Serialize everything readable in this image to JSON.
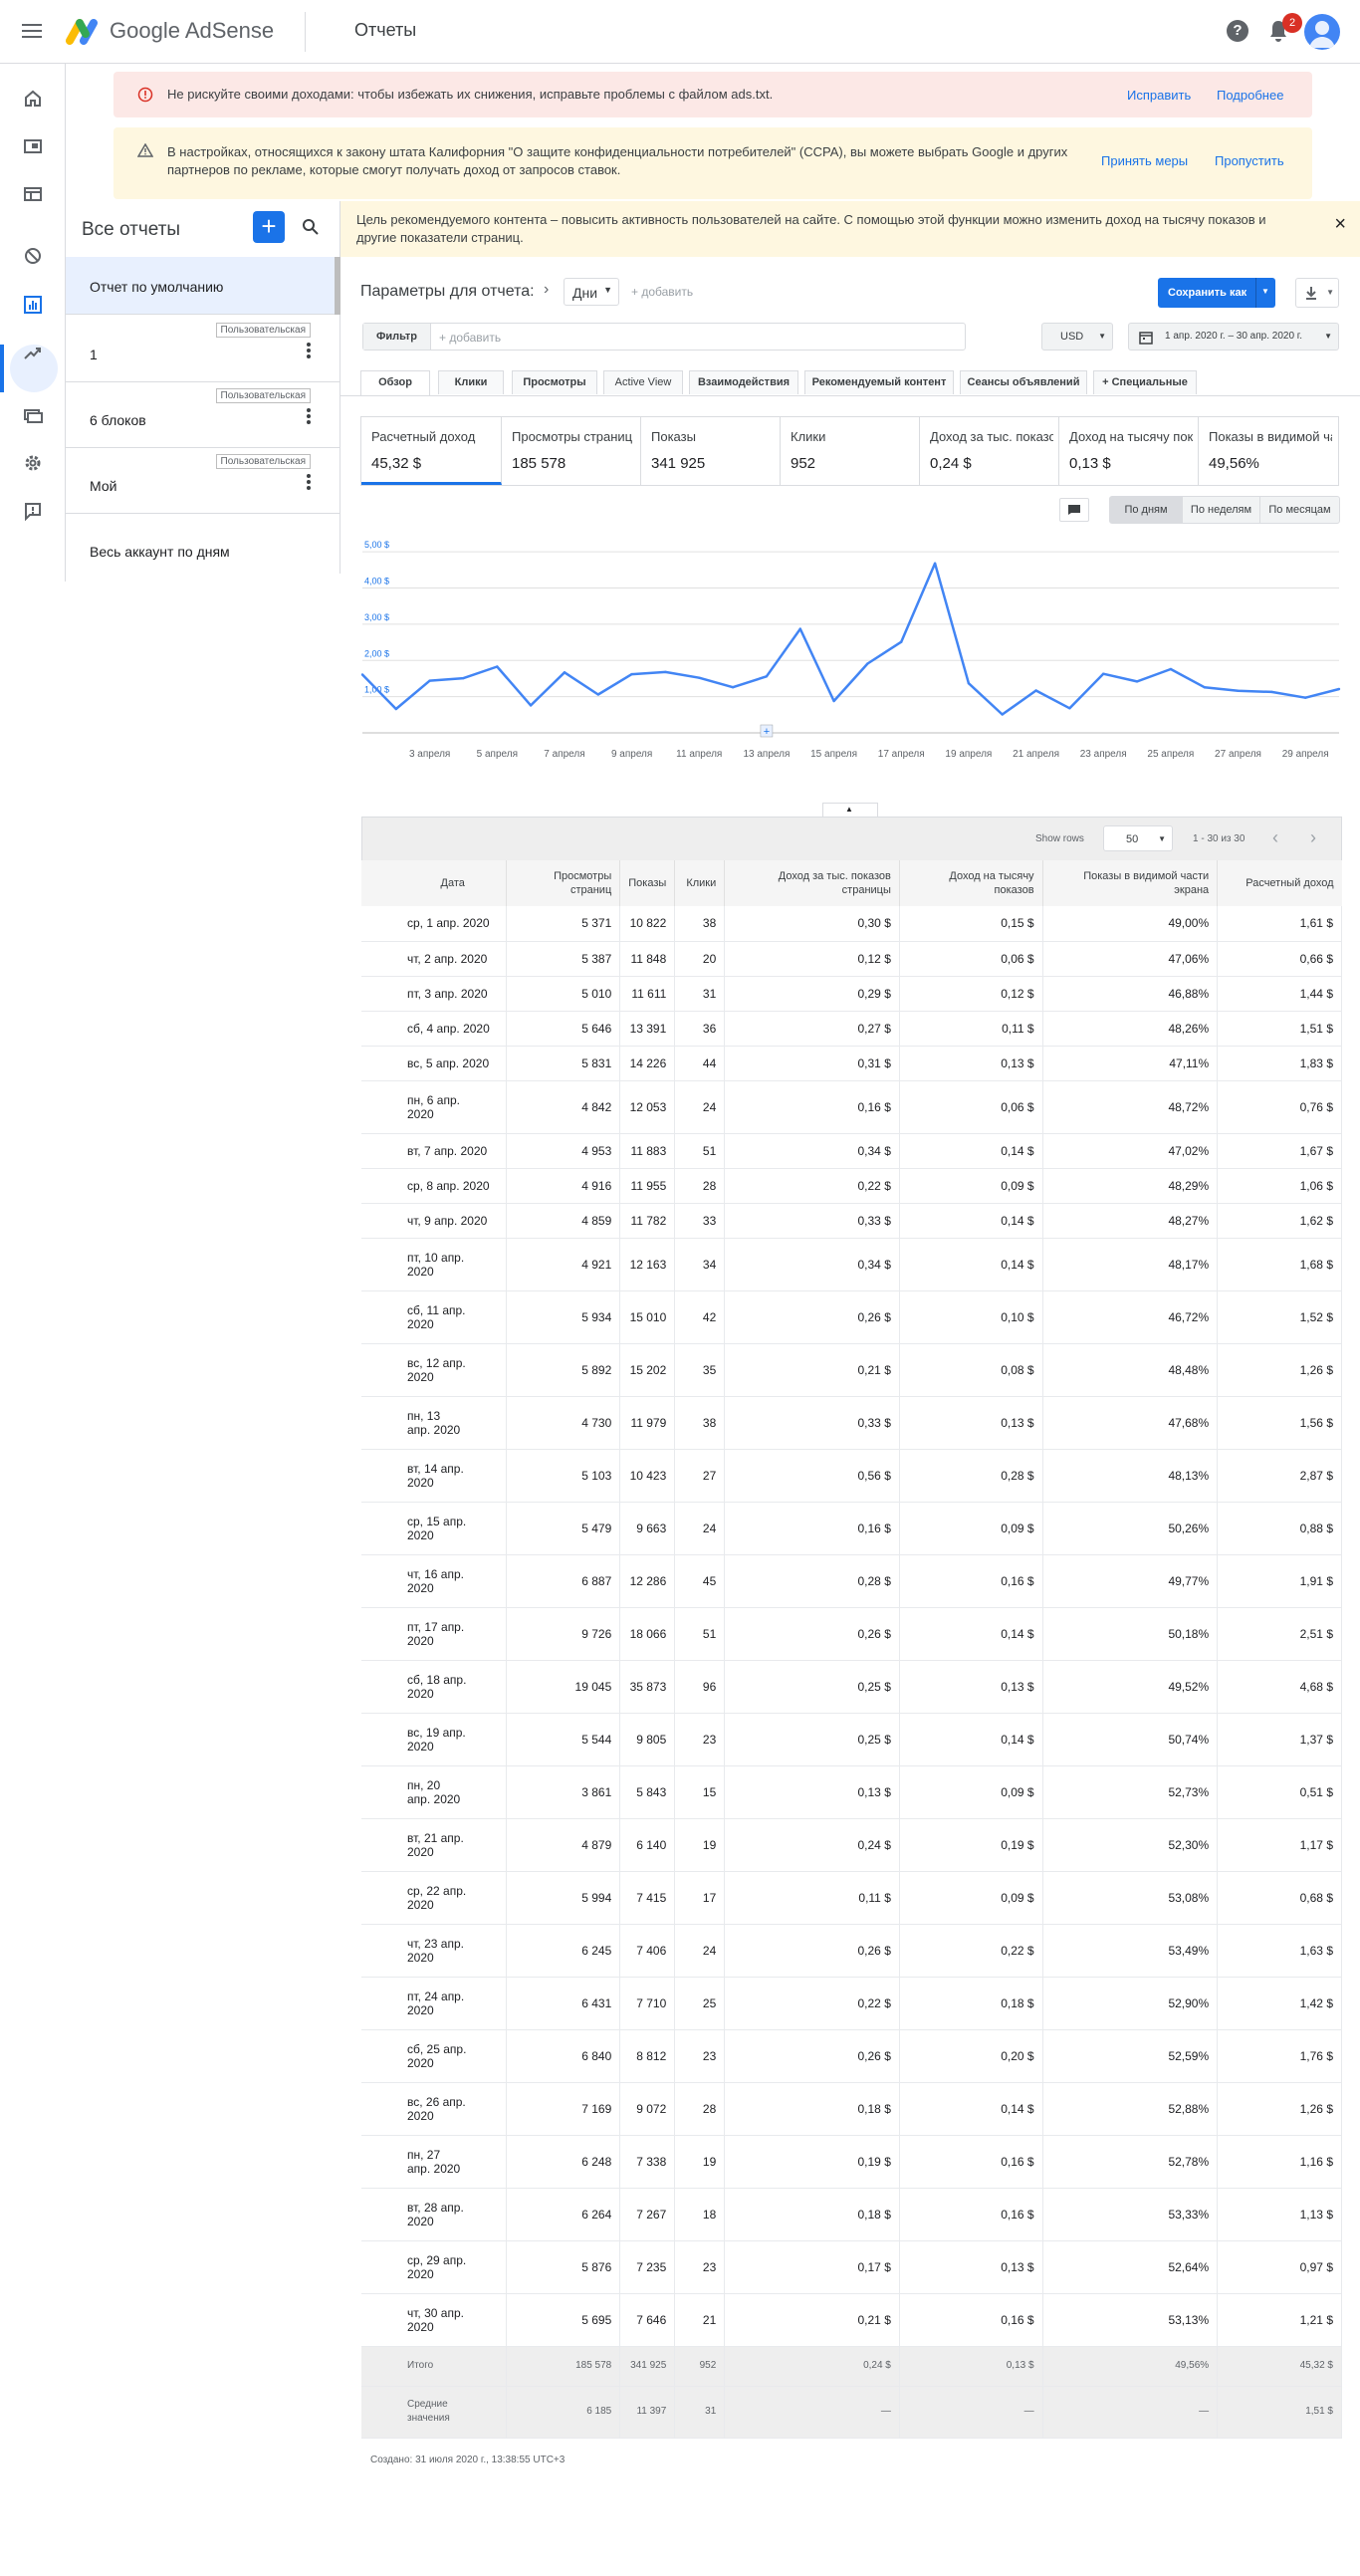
{
  "app": {
    "brand": "Google AdSense",
    "page_title": "Отчеты",
    "notification_count": "2"
  },
  "alerts": [
    {
      "text": "Не рискуйте своими доходами: чтобы избежать их снижения, исправьте проблемы с файлом ads.txt.",
      "action1": "Исправить",
      "action2": "Подробнее"
    },
    {
      "text": "В настройках, относящихся к закону штата Калифорния \"О защите конфиденциальности потребителей\" (CCPA), вы можете выбрать Google и других партнеров по рекламе, которые смогут получать доход от запросов ставок.",
      "action1": "Принять меры",
      "action2": "Пропустить"
    }
  ],
  "reports_panel": {
    "title": "Все отчеты",
    "items": [
      {
        "label": "Отчет по умолчанию",
        "tag": ""
      },
      {
        "label": "1",
        "tag": "Пользовательская"
      },
      {
        "label": "6 блоков",
        "tag": "Пользовательская"
      },
      {
        "label": "Мой",
        "tag": "Пользовательская"
      },
      {
        "label": "Весь аккаунт по дням",
        "tag": ""
      }
    ]
  },
  "banner": {
    "text": "Цель рекомендуемого контента – повысить активность пользователей на сайте. С помощью этой функции можно изменить доход на тысячу показов и другие показатели страниц.",
    "close": "×"
  },
  "params": {
    "label": "Параметры для отчета:",
    "dimension": "Дни",
    "add": "+ добавить",
    "save": "Сохранить как"
  },
  "filter": {
    "label": "Фильтр",
    "placeholder": "+ добавить",
    "currency": "USD",
    "date_range": "1 апр. 2020 г. – 30 апр. 2020 г."
  },
  "tabs": [
    "Обзор",
    "Клики",
    "Просмотры",
    "Active View",
    "Взаимодействия",
    "Рекомендуемый контент",
    "Сеансы объявлений",
    "+  Специальные"
  ],
  "metrics": [
    {
      "label": "Расчетный доход",
      "value": "45,32 $"
    },
    {
      "label": "Просмотры страниц",
      "value": "185 578"
    },
    {
      "label": "Показы",
      "value": "341 925"
    },
    {
      "label": "Клики",
      "value": "952"
    },
    {
      "label": "Доход за тыс. показов страницы",
      "value": "0,24 $"
    },
    {
      "label": "Доход на тысячу показов",
      "value": "0,13 $"
    },
    {
      "label": "Показы в видимой части экрана",
      "value": "49,56%"
    }
  ],
  "granularity": [
    "По дням",
    "По неделям",
    "По месяцам"
  ],
  "chart_data": {
    "type": "line",
    "series": [
      {
        "name": "Расчетный доход",
        "values": [
          1.61,
          0.66,
          1.44,
          1.51,
          1.83,
          0.76,
          1.67,
          1.06,
          1.62,
          1.68,
          1.52,
          1.26,
          1.56,
          2.87,
          0.88,
          1.91,
          2.51,
          4.68,
          1.37,
          0.51,
          1.17,
          0.68,
          1.63,
          1.42,
          1.76,
          1.26,
          1.16,
          1.13,
          0.97,
          1.21
        ]
      }
    ],
    "x_labels": [
      "3 апреля",
      "5 апреля",
      "7 апреля",
      "9 апреля",
      "11 апреля",
      "13 апреля",
      "15 апреля",
      "17 апреля",
      "19 апреля",
      "21 апреля",
      "23 апреля",
      "25 апреля",
      "27 апреля",
      "29 апреля"
    ],
    "y_ticks": [
      "1,00 $",
      "2,00 $",
      "3,00 $",
      "4,00 $",
      "5,00 $"
    ],
    "ylim": [
      0,
      5.5
    ],
    "color": "#4285f4"
  },
  "table": {
    "show_rows_label": "Show rows",
    "rows_per_page": "50",
    "range": "1 - 30 из 30",
    "headers": [
      "Дата",
      "Просмотры страниц",
      "Показы",
      "Клики",
      "Доход за тыс. показов страницы",
      "Доход на тысячу показов",
      "Показы в видимой части экрана",
      "Расчетный доход"
    ],
    "rows": [
      [
        "ср, 1 апр. 2020",
        "5 371",
        "10 822",
        "38",
        "0,30 $",
        "0,15 $",
        "49,00%",
        "1,61 $"
      ],
      [
        "чт, 2 апр. 2020",
        "5 387",
        "11 848",
        "20",
        "0,12 $",
        "0,06 $",
        "47,06%",
        "0,66 $"
      ],
      [
        "пт, 3 апр. 2020",
        "5 010",
        "11 611",
        "31",
        "0,29 $",
        "0,12 $",
        "46,88%",
        "1,44 $"
      ],
      [
        "сб, 4 апр. 2020",
        "5 646",
        "13 391",
        "36",
        "0,27 $",
        "0,11 $",
        "48,26%",
        "1,51 $"
      ],
      [
        "вс, 5 апр. 2020",
        "5 831",
        "14 226",
        "44",
        "0,31 $",
        "0,13 $",
        "47,11%",
        "1,83 $"
      ],
      [
        "пн, 6 апр. 2020",
        "4 842",
        "12 053",
        "24",
        "0,16 $",
        "0,06 $",
        "48,72%",
        "0,76 $"
      ],
      [
        "вт, 7 апр. 2020",
        "4 953",
        "11 883",
        "51",
        "0,34 $",
        "0,14 $",
        "47,02%",
        "1,67 $"
      ],
      [
        "ср, 8 апр. 2020",
        "4 916",
        "11 955",
        "28",
        "0,22 $",
        "0,09 $",
        "48,29%",
        "1,06 $"
      ],
      [
        "чт, 9 апр. 2020",
        "4 859",
        "11 782",
        "33",
        "0,33 $",
        "0,14 $",
        "48,27%",
        "1,62 $"
      ],
      [
        "пт, 10 апр. 2020",
        "4 921",
        "12 163",
        "34",
        "0,34 $",
        "0,14 $",
        "48,17%",
        "1,68 $"
      ],
      [
        "сб, 11 апр. 2020",
        "5 934",
        "15 010",
        "42",
        "0,26 $",
        "0,10 $",
        "46,72%",
        "1,52 $"
      ],
      [
        "вс, 12 апр. 2020",
        "5 892",
        "15 202",
        "35",
        "0,21 $",
        "0,08 $",
        "48,48%",
        "1,26 $"
      ],
      [
        "пн, 13 апр. 2020",
        "4 730",
        "11 979",
        "38",
        "0,33 $",
        "0,13 $",
        "47,68%",
        "1,56 $"
      ],
      [
        "вт, 14 апр. 2020",
        "5 103",
        "10 423",
        "27",
        "0,56 $",
        "0,28 $",
        "48,13%",
        "2,87 $"
      ],
      [
        "ср, 15 апр. 2020",
        "5 479",
        "9 663",
        "24",
        "0,16 $",
        "0,09 $",
        "50,26%",
        "0,88 $"
      ],
      [
        "чт, 16 апр. 2020",
        "6 887",
        "12 286",
        "45",
        "0,28 $",
        "0,16 $",
        "49,77%",
        "1,91 $"
      ],
      [
        "пт, 17 апр. 2020",
        "9 726",
        "18 066",
        "51",
        "0,26 $",
        "0,14 $",
        "50,18%",
        "2,51 $"
      ],
      [
        "сб, 18 апр. 2020",
        "19 045",
        "35 873",
        "96",
        "0,25 $",
        "0,13 $",
        "49,52%",
        "4,68 $"
      ],
      [
        "вс, 19 апр. 2020",
        "5 544",
        "9 805",
        "23",
        "0,25 $",
        "0,14 $",
        "50,74%",
        "1,37 $"
      ],
      [
        "пн, 20 апр. 2020",
        "3 861",
        "5 843",
        "15",
        "0,13 $",
        "0,09 $",
        "52,73%",
        "0,51 $"
      ],
      [
        "вт, 21 апр. 2020",
        "4 879",
        "6 140",
        "19",
        "0,24 $",
        "0,19 $",
        "52,30%",
        "1,17 $"
      ],
      [
        "ср, 22 апр. 2020",
        "5 994",
        "7 415",
        "17",
        "0,11 $",
        "0,09 $",
        "53,08%",
        "0,68 $"
      ],
      [
        "чт, 23 апр. 2020",
        "6 245",
        "7 406",
        "24",
        "0,26 $",
        "0,22 $",
        "53,49%",
        "1,63 $"
      ],
      [
        "пт, 24 апр. 2020",
        "6 431",
        "7 710",
        "25",
        "0,22 $",
        "0,18 $",
        "52,90%",
        "1,42 $"
      ],
      [
        "сб, 25 апр. 2020",
        "6 840",
        "8 812",
        "23",
        "0,26 $",
        "0,20 $",
        "52,59%",
        "1,76 $"
      ],
      [
        "вс, 26 апр. 2020",
        "7 169",
        "9 072",
        "28",
        "0,18 $",
        "0,14 $",
        "52,88%",
        "1,26 $"
      ],
      [
        "пн, 27 апр. 2020",
        "6 248",
        "7 338",
        "19",
        "0,19 $",
        "0,16 $",
        "52,78%",
        "1,16 $"
      ],
      [
        "вт, 28 апр. 2020",
        "6 264",
        "7 267",
        "18",
        "0,18 $",
        "0,16 $",
        "53,33%",
        "1,13 $"
      ],
      [
        "ср, 29 апр. 2020",
        "5 876",
        "7 235",
        "23",
        "0,17 $",
        "0,13 $",
        "52,64%",
        "0,97 $"
      ],
      [
        "чт, 30 апр. 2020",
        "5 695",
        "7 646",
        "21",
        "0,21 $",
        "0,16 $",
        "53,13%",
        "1,21 $"
      ]
    ],
    "total": [
      "Итого",
      "185 578",
      "341 925",
      "952",
      "0,24 $",
      "0,13 $",
      "49,56%",
      "45,32 $"
    ],
    "average": [
      "Средние значения",
      "6 185",
      "11 397",
      "31",
      "—",
      "—",
      "—",
      "1,51 $"
    ]
  },
  "footer": {
    "created": "Создано: 31 июля 2020 г., 13:38:55 UTC+3"
  }
}
